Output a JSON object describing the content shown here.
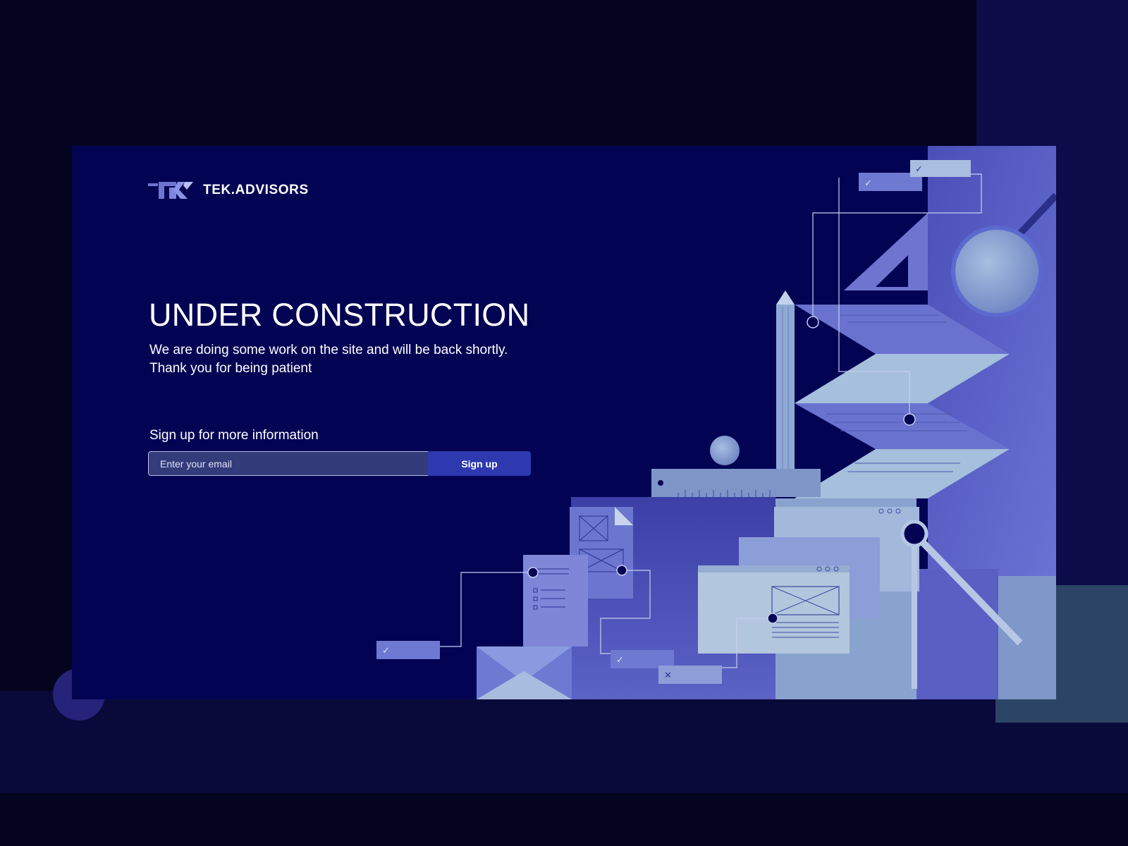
{
  "brand": {
    "name": "TEK.ADVISORS",
    "logo_icon": "tk-logo-mark"
  },
  "hero": {
    "title": "UNDER CONSTRUCTION",
    "line1": "We are doing some work on the site and will be back shortly.",
    "line2": "Thank you for being patient"
  },
  "signup": {
    "label": "Sign up for more information",
    "email_placeholder": "Enter your email",
    "button_label": "Sign up"
  },
  "colors": {
    "page_bg": "#04041f",
    "card_bg": "#030354",
    "accent": "#2e39b0",
    "input_bg": "#333b7a",
    "illustration_light": "#8fb3cc",
    "illustration_mid": "#6f74cf"
  }
}
